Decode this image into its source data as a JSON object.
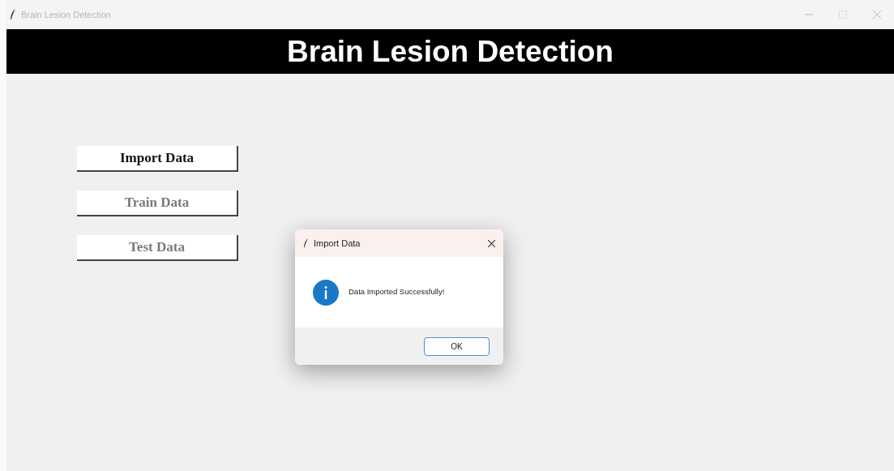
{
  "window": {
    "title": "Brain Lesion Detection"
  },
  "header": {
    "title": "Brain Lesion Detection"
  },
  "buttons": [
    {
      "label": "Import Data",
      "disabled": false
    },
    {
      "label": "Train Data",
      "disabled": true
    },
    {
      "label": "Test Data",
      "disabled": true
    }
  ],
  "dialog": {
    "title": "Import Data",
    "message": "Data Imported Successfully!",
    "ok_label": "OK"
  }
}
